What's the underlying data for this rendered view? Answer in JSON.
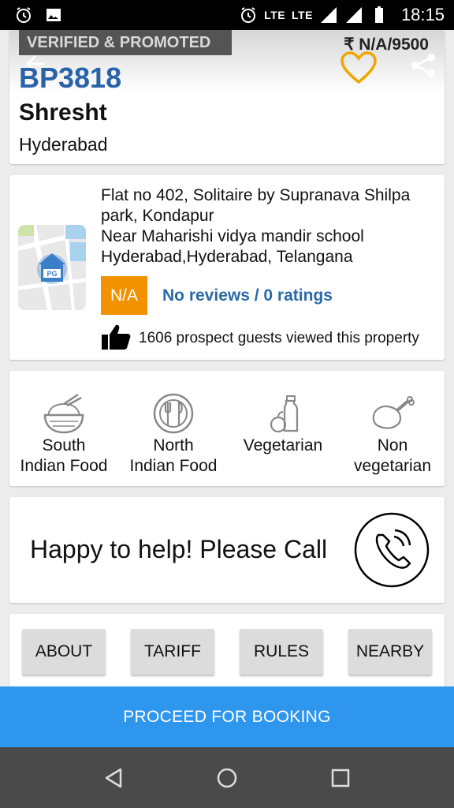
{
  "status_bar": {
    "lte_1": "LTE",
    "lte_2": "LTE",
    "time": "18:15",
    "icons": [
      "alarm-icon",
      "image-icon",
      "alarm-clock-icon",
      "signal-icon",
      "signal-icon",
      "battery-icon"
    ]
  },
  "header": {
    "badge": "VERIFIED & PROMOTED",
    "price": "₹ N/A/9500",
    "code": "BP3818",
    "name": "Shresht",
    "city": "Hyderabad",
    "heart_color": "#f0a500",
    "code_color": "#2a62a8"
  },
  "address": {
    "lines": [
      "Flat no 402, Solitaire by Supranava Shilpa",
      "park, Kondapur",
      "Near Maharishi vidya mandir school",
      "Hyderabad,Hyderabad, Telangana"
    ],
    "map_badge": "PG",
    "rating": "N/A",
    "reviews": "No reviews / 0 ratings",
    "views": "1606 prospect guests viewed this property",
    "rating_color": "#f39200"
  },
  "food": {
    "items": [
      {
        "line1": "South",
        "line2": "Indian Food",
        "icon": "rice-bowl-icon"
      },
      {
        "line1": "North",
        "line2": "Indian Food",
        "icon": "cutlery-icon"
      },
      {
        "line1": "Vegetarian",
        "line2": "",
        "icon": "vegetarian-icon"
      },
      {
        "line1": "Non",
        "line2": "vegetarian",
        "icon": "chicken-icon"
      }
    ]
  },
  "help": {
    "text": "Happy to help! Please Call"
  },
  "tabs": [
    "ABOUT",
    "TARIFF",
    "RULES",
    "NEARBY"
  ],
  "booking": {
    "label": "PROCEED FOR BOOKING",
    "color": "#2f96ee"
  }
}
